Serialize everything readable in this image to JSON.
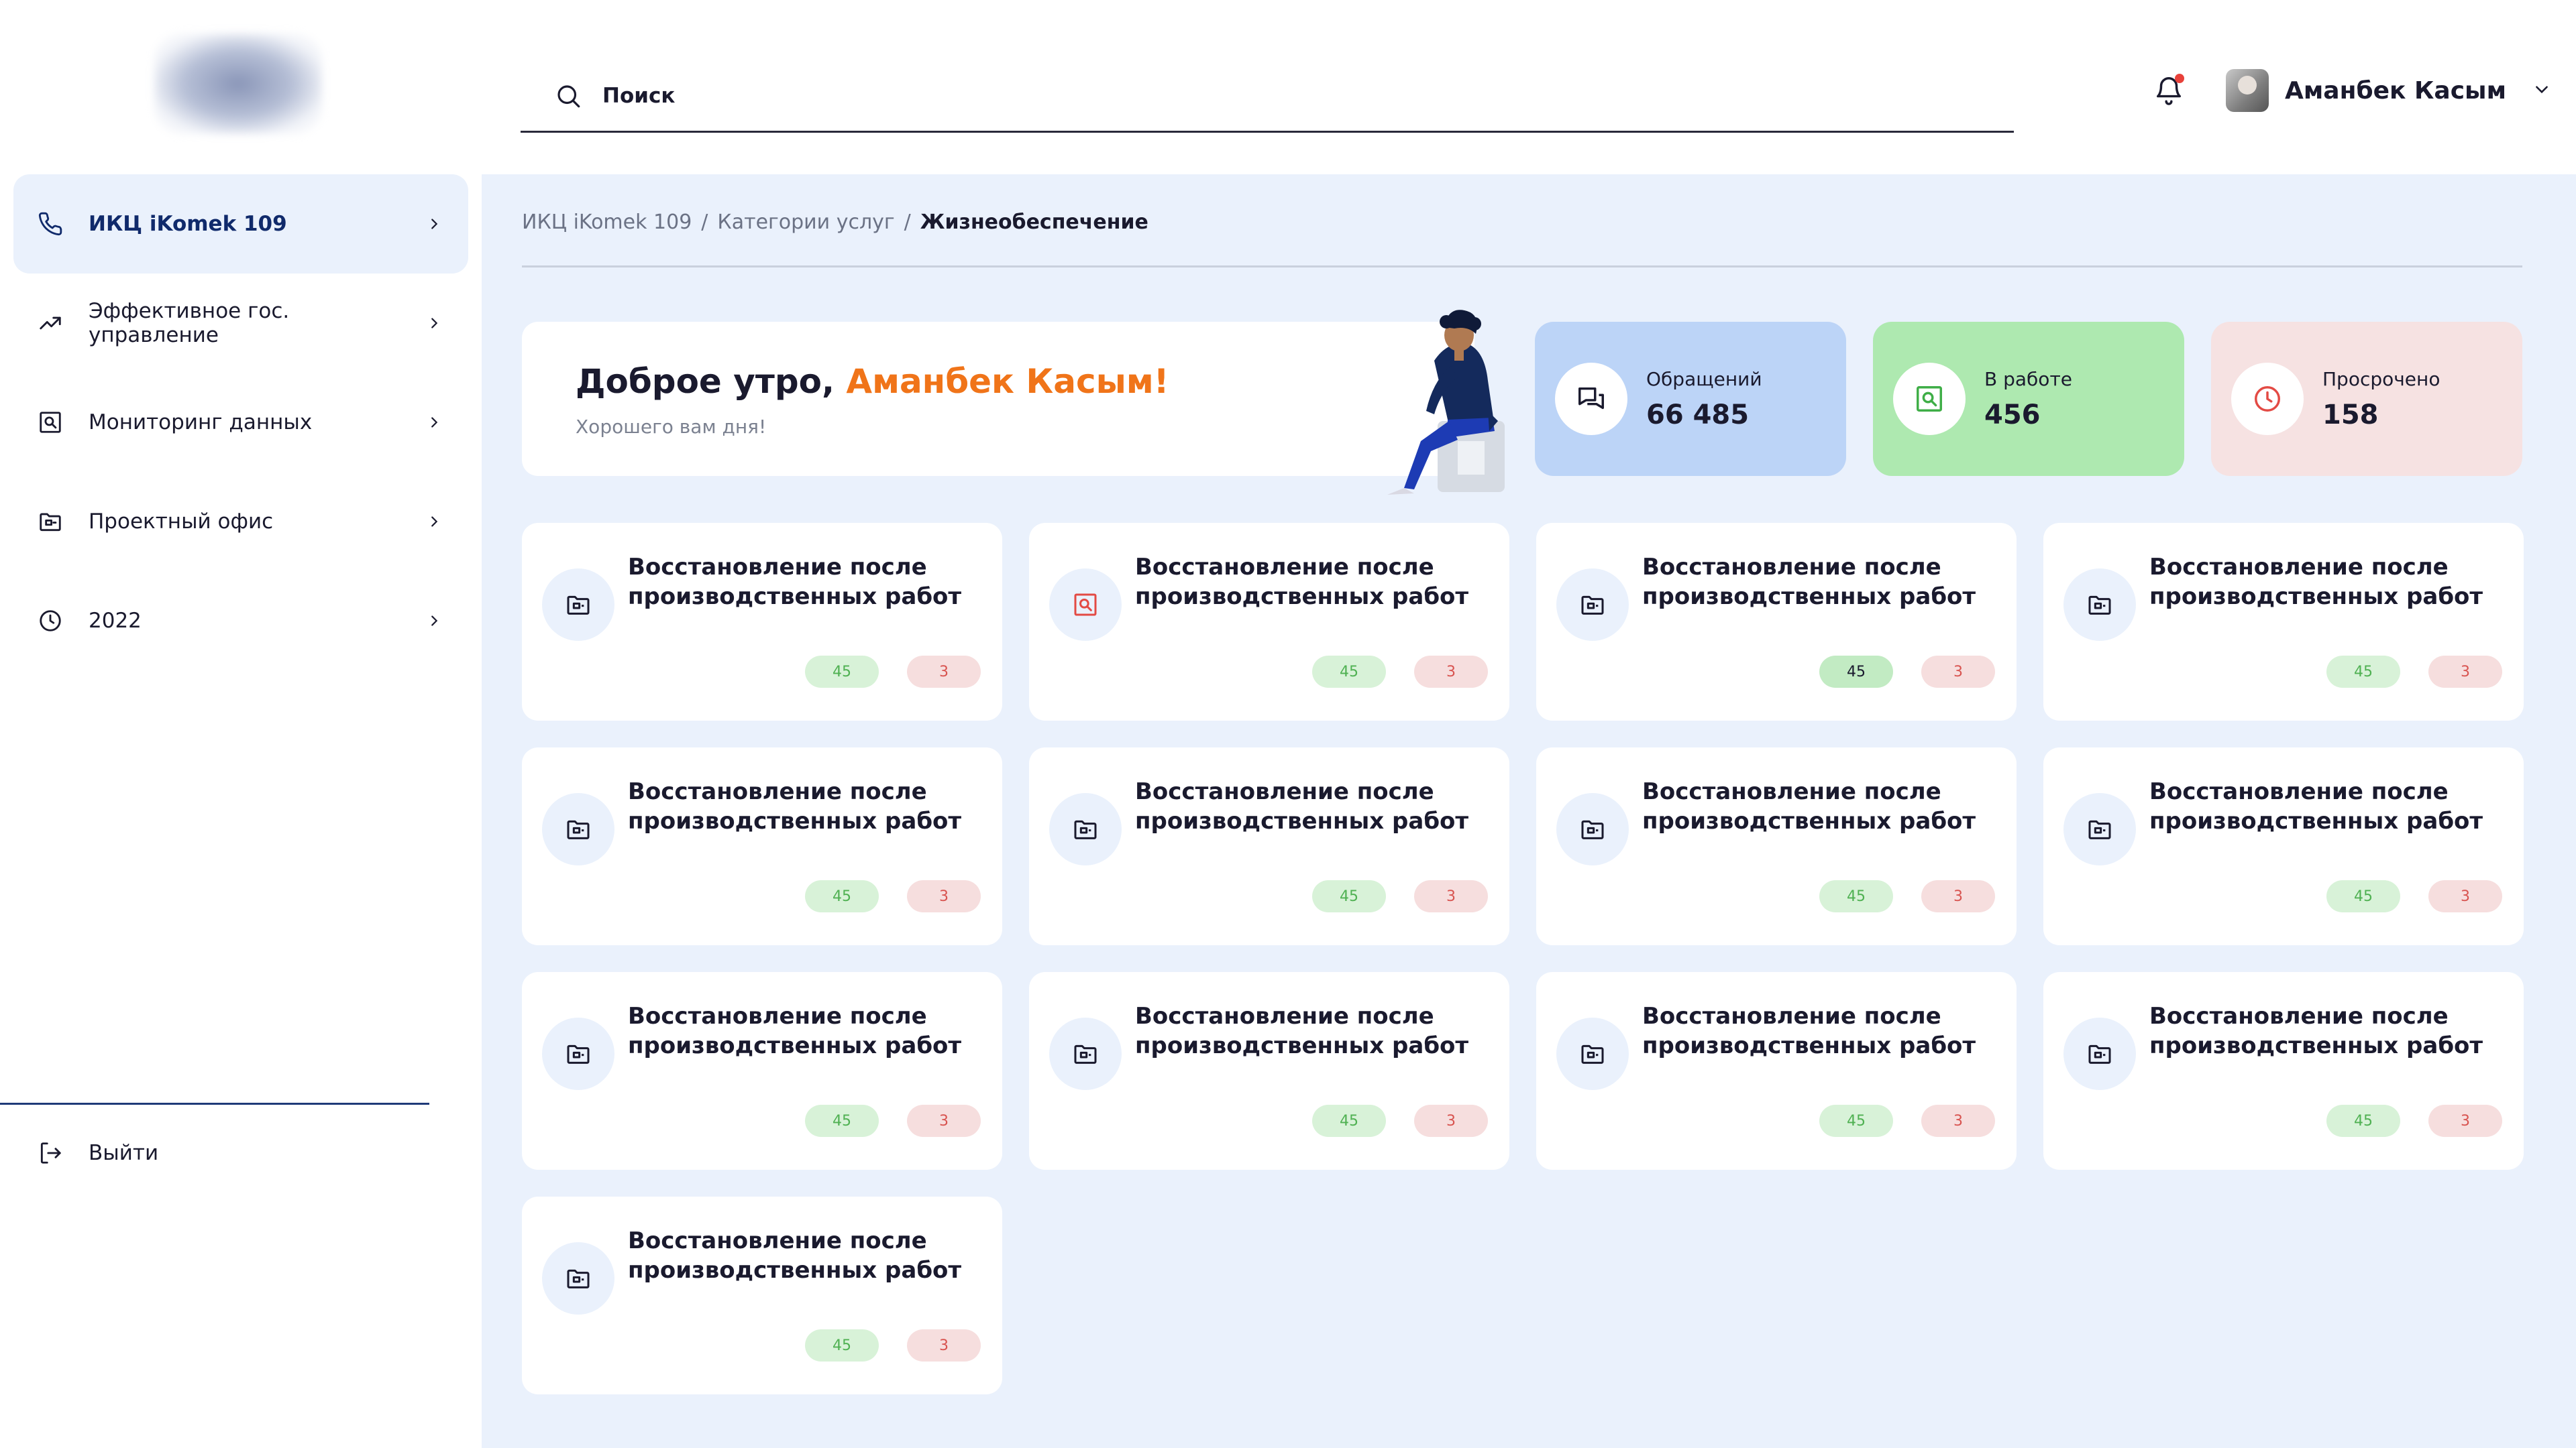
{
  "sidebar": {
    "items": [
      {
        "label": "ИКЦ iKomek 109",
        "icon": "phone-icon",
        "active": true
      },
      {
        "label": "Эффективное гос. управление",
        "icon": "trend-up-icon"
      },
      {
        "label": "Мониторинг данных",
        "icon": "monitor-search-icon"
      },
      {
        "label": "Проектный офис",
        "icon": "folder-icon"
      },
      {
        "label": "2022",
        "icon": "clock-icon"
      }
    ],
    "logout_label": "Выйти"
  },
  "header": {
    "search_placeholder": "Поиск",
    "user_name": "Аманбек Касым"
  },
  "breadcrumb": {
    "items": [
      "ИКЦ iKomek 109",
      "Категории услуг",
      "Жизнеобеспечение"
    ],
    "separator": "/"
  },
  "greeting": {
    "prefix": "Доброе утро, ",
    "name": "Аманбек Касым!",
    "subtitle": "Хорошего вам дня!"
  },
  "stats": [
    {
      "label": "Обращений",
      "value": "66 485",
      "color": "#bcd4f7",
      "icon": "chat-icon"
    },
    {
      "label": "В работе",
      "value": "456",
      "color": "#aee9b0",
      "icon": "search-doc-icon"
    },
    {
      "label": "Просрочено",
      "value": "158",
      "color": "#f6e2e2",
      "icon": "clock-icon"
    }
  ],
  "cards": [
    {
      "title": "Восстановление после производственных работ",
      "green": "45",
      "red": "3",
      "icon": "folder-icon"
    },
    {
      "title": "Восстановление после производственных работ",
      "green": "45",
      "red": "3",
      "icon": "search-doc-icon"
    },
    {
      "title": "Восстановление после производственных работ",
      "green": "45",
      "red": "3",
      "icon": "folder-icon"
    },
    {
      "title": "Восстановление после производственных работ",
      "green": "45",
      "red": "3",
      "icon": "folder-icon"
    },
    {
      "title": "Восстановление после производственных работ",
      "green": "45",
      "red": "3",
      "icon": "folder-icon"
    },
    {
      "title": "Восстановление после производственных работ",
      "green": "45",
      "red": "3",
      "icon": "folder-icon"
    },
    {
      "title": "Восстановление после производственных работ",
      "green": "45",
      "red": "3",
      "icon": "folder-icon"
    },
    {
      "title": "Восстановление после производственных работ",
      "green": "45",
      "red": "3",
      "icon": "folder-icon"
    },
    {
      "title": "Восстановление после производственных работ",
      "green": "45",
      "red": "3",
      "icon": "folder-icon"
    },
    {
      "title": "Восстановление после производственных работ",
      "green": "45",
      "red": "3",
      "icon": "folder-icon"
    },
    {
      "title": "Восстановление после производственных работ",
      "green": "45",
      "red": "3",
      "icon": "folder-icon"
    },
    {
      "title": "Восстановление после производственных работ",
      "green": "45",
      "red": "3",
      "icon": "folder-icon"
    },
    {
      "title": "Восстановление после производственных работ",
      "green": "45",
      "red": "3",
      "icon": "folder-icon"
    }
  ],
  "colors": {
    "accent": "#f07419",
    "main_bg": "#eaf1fc",
    "nav_active": "#102a6b"
  }
}
